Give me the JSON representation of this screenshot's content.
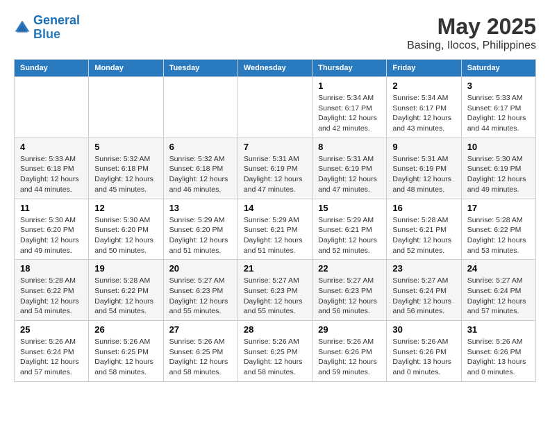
{
  "logo": {
    "line1": "General",
    "line2": "Blue"
  },
  "title": "May 2025",
  "subtitle": "Basing, Ilocos, Philippines",
  "days_of_week": [
    "Sunday",
    "Monday",
    "Tuesday",
    "Wednesday",
    "Thursday",
    "Friday",
    "Saturday"
  ],
  "weeks": [
    [
      {
        "day": "",
        "info": ""
      },
      {
        "day": "",
        "info": ""
      },
      {
        "day": "",
        "info": ""
      },
      {
        "day": "",
        "info": ""
      },
      {
        "day": "1",
        "info": "Sunrise: 5:34 AM\nSunset: 6:17 PM\nDaylight: 12 hours\nand 42 minutes."
      },
      {
        "day": "2",
        "info": "Sunrise: 5:34 AM\nSunset: 6:17 PM\nDaylight: 12 hours\nand 43 minutes."
      },
      {
        "day": "3",
        "info": "Sunrise: 5:33 AM\nSunset: 6:17 PM\nDaylight: 12 hours\nand 44 minutes."
      }
    ],
    [
      {
        "day": "4",
        "info": "Sunrise: 5:33 AM\nSunset: 6:18 PM\nDaylight: 12 hours\nand 44 minutes."
      },
      {
        "day": "5",
        "info": "Sunrise: 5:32 AM\nSunset: 6:18 PM\nDaylight: 12 hours\nand 45 minutes."
      },
      {
        "day": "6",
        "info": "Sunrise: 5:32 AM\nSunset: 6:18 PM\nDaylight: 12 hours\nand 46 minutes."
      },
      {
        "day": "7",
        "info": "Sunrise: 5:31 AM\nSunset: 6:19 PM\nDaylight: 12 hours\nand 47 minutes."
      },
      {
        "day": "8",
        "info": "Sunrise: 5:31 AM\nSunset: 6:19 PM\nDaylight: 12 hours\nand 47 minutes."
      },
      {
        "day": "9",
        "info": "Sunrise: 5:31 AM\nSunset: 6:19 PM\nDaylight: 12 hours\nand 48 minutes."
      },
      {
        "day": "10",
        "info": "Sunrise: 5:30 AM\nSunset: 6:19 PM\nDaylight: 12 hours\nand 49 minutes."
      }
    ],
    [
      {
        "day": "11",
        "info": "Sunrise: 5:30 AM\nSunset: 6:20 PM\nDaylight: 12 hours\nand 49 minutes."
      },
      {
        "day": "12",
        "info": "Sunrise: 5:30 AM\nSunset: 6:20 PM\nDaylight: 12 hours\nand 50 minutes."
      },
      {
        "day": "13",
        "info": "Sunrise: 5:29 AM\nSunset: 6:20 PM\nDaylight: 12 hours\nand 51 minutes."
      },
      {
        "day": "14",
        "info": "Sunrise: 5:29 AM\nSunset: 6:21 PM\nDaylight: 12 hours\nand 51 minutes."
      },
      {
        "day": "15",
        "info": "Sunrise: 5:29 AM\nSunset: 6:21 PM\nDaylight: 12 hours\nand 52 minutes."
      },
      {
        "day": "16",
        "info": "Sunrise: 5:28 AM\nSunset: 6:21 PM\nDaylight: 12 hours\nand 52 minutes."
      },
      {
        "day": "17",
        "info": "Sunrise: 5:28 AM\nSunset: 6:22 PM\nDaylight: 12 hours\nand 53 minutes."
      }
    ],
    [
      {
        "day": "18",
        "info": "Sunrise: 5:28 AM\nSunset: 6:22 PM\nDaylight: 12 hours\nand 54 minutes."
      },
      {
        "day": "19",
        "info": "Sunrise: 5:28 AM\nSunset: 6:22 PM\nDaylight: 12 hours\nand 54 minutes."
      },
      {
        "day": "20",
        "info": "Sunrise: 5:27 AM\nSunset: 6:23 PM\nDaylight: 12 hours\nand 55 minutes."
      },
      {
        "day": "21",
        "info": "Sunrise: 5:27 AM\nSunset: 6:23 PM\nDaylight: 12 hours\nand 55 minutes."
      },
      {
        "day": "22",
        "info": "Sunrise: 5:27 AM\nSunset: 6:23 PM\nDaylight: 12 hours\nand 56 minutes."
      },
      {
        "day": "23",
        "info": "Sunrise: 5:27 AM\nSunset: 6:24 PM\nDaylight: 12 hours\nand 56 minutes."
      },
      {
        "day": "24",
        "info": "Sunrise: 5:27 AM\nSunset: 6:24 PM\nDaylight: 12 hours\nand 57 minutes."
      }
    ],
    [
      {
        "day": "25",
        "info": "Sunrise: 5:26 AM\nSunset: 6:24 PM\nDaylight: 12 hours\nand 57 minutes."
      },
      {
        "day": "26",
        "info": "Sunrise: 5:26 AM\nSunset: 6:25 PM\nDaylight: 12 hours\nand 58 minutes."
      },
      {
        "day": "27",
        "info": "Sunrise: 5:26 AM\nSunset: 6:25 PM\nDaylight: 12 hours\nand 58 minutes."
      },
      {
        "day": "28",
        "info": "Sunrise: 5:26 AM\nSunset: 6:25 PM\nDaylight: 12 hours\nand 58 minutes."
      },
      {
        "day": "29",
        "info": "Sunrise: 5:26 AM\nSunset: 6:26 PM\nDaylight: 12 hours\nand 59 minutes."
      },
      {
        "day": "30",
        "info": "Sunrise: 5:26 AM\nSunset: 6:26 PM\nDaylight: 13 hours\nand 0 minutes."
      },
      {
        "day": "31",
        "info": "Sunrise: 5:26 AM\nSunset: 6:26 PM\nDaylight: 13 hours\nand 0 minutes."
      }
    ]
  ]
}
